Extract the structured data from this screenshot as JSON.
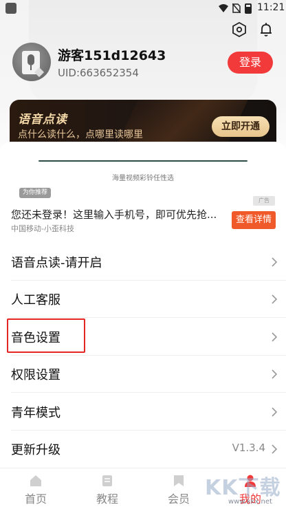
{
  "status_bar": {
    "time": "11:21"
  },
  "profile": {
    "username": "游客151d12643",
    "uid": "UID:663652354",
    "login_label": "登录"
  },
  "vip_banner": {
    "title": "语音点读",
    "subtitle": "点什么读什么，点哪里读哪里",
    "button": "立即开通"
  },
  "ad": {
    "caption": "海量视频彩铃任性选",
    "badge": "为你推荐",
    "tag": "广告",
    "title": "您还未登录！这里输入手机号，即可优先抢...",
    "source": "中国移动-小歪科技",
    "button": "查看详情"
  },
  "menu": [
    {
      "label": "语音点读-请开启",
      "value": ""
    },
    {
      "label": "人工客服",
      "value": ""
    },
    {
      "label": "音色设置",
      "value": ""
    },
    {
      "label": "权限设置",
      "value": ""
    },
    {
      "label": "青年模式",
      "value": ""
    },
    {
      "label": "更新升级",
      "value": "V1.3.4"
    }
  ],
  "nav": [
    {
      "label": "首页",
      "icon": "home-icon",
      "active": false
    },
    {
      "label": "教程",
      "icon": "tutorial-icon",
      "active": false
    },
    {
      "label": "会员",
      "icon": "member-icon",
      "active": false
    },
    {
      "label": "我的",
      "icon": "profile-icon",
      "active": true
    }
  ],
  "watermark": {
    "text": "KK下载",
    "url": "www.kkx.net"
  },
  "colors": {
    "accent": "#f23a3a",
    "vip_gold": "#f5d9a8",
    "vip_dark": "#1d1512",
    "ad_button": "#f05a2a"
  }
}
